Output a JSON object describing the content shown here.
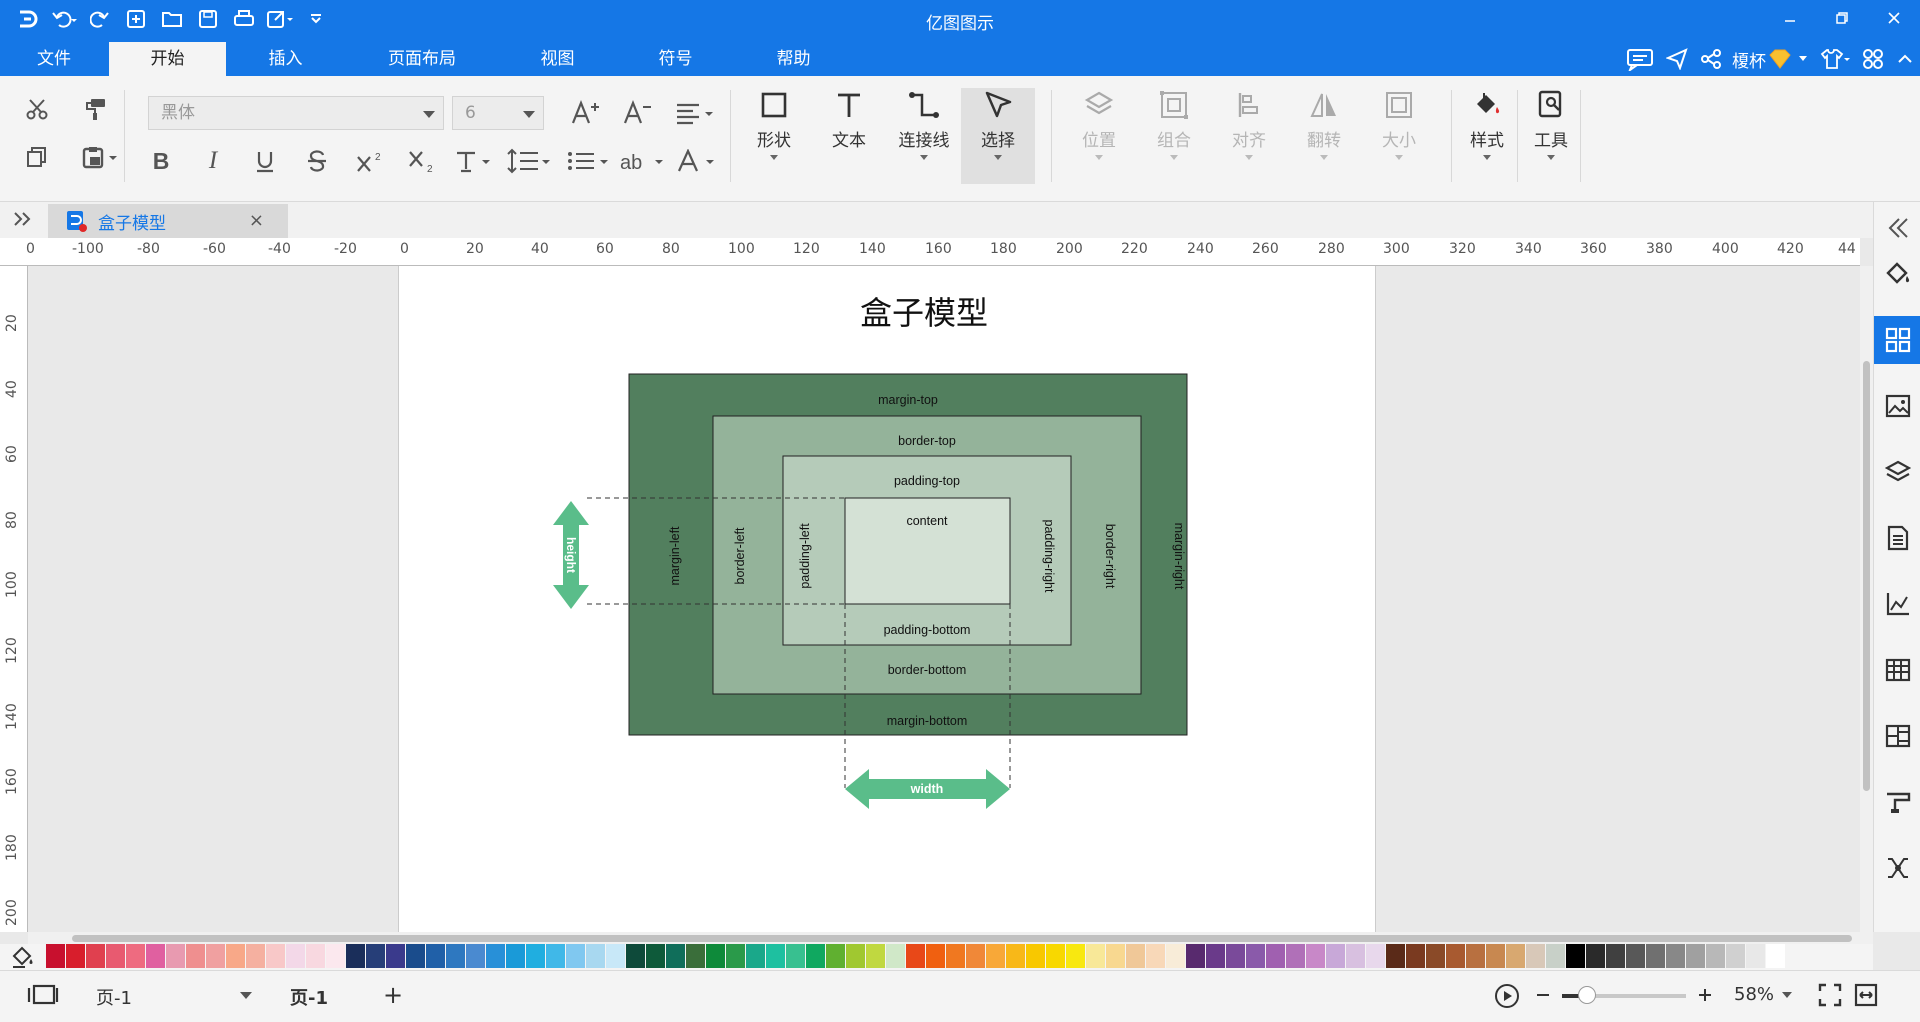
{
  "app": {
    "title": "亿图图示",
    "user": "榎杯"
  },
  "menus": [
    "文件",
    "开始",
    "插入",
    "页面布局",
    "视图",
    "符号",
    "帮助"
  ],
  "ribbon": {
    "font_name": "黑体",
    "font_size": "6",
    "buttons": {
      "shape": "形状",
      "text": "文本",
      "connector": "连接线",
      "select": "选择",
      "position": "位置",
      "group": "组合",
      "align": "对齐",
      "flip": "翻转",
      "size": "大小",
      "style": "样式",
      "tools": "工具"
    }
  },
  "document": {
    "tab_title": "盒子模型",
    "close": "×"
  },
  "ruler": {
    "h": [
      "0",
      "-100",
      "-80",
      "-60",
      "-40",
      "-20",
      "0",
      "20",
      "40",
      "60",
      "80",
      "100",
      "120",
      "140",
      "160",
      "180",
      "200",
      "220",
      "240",
      "260",
      "280",
      "300",
      "320",
      "340",
      "360",
      "380",
      "400",
      "420",
      "44"
    ],
    "v": [
      "20",
      "40",
      "60",
      "80",
      "100",
      "120",
      "140",
      "160",
      "180",
      "200"
    ]
  },
  "diagram": {
    "title": "盒子模型",
    "margin_top": "margin-top",
    "border_top": "border-top",
    "padding_top": "padding-top",
    "content": "content",
    "padding_bottom": "padding-bottom",
    "border_bottom": "border-bottom",
    "margin_bottom": "margin-bottom",
    "margin_left": "margin-left",
    "border_left": "border-left",
    "padding_left": "padding-left",
    "padding_right": "padding-right",
    "border_right": "border-right",
    "margin_right": "margin-right",
    "height": "height",
    "width": "width",
    "colors": {
      "margin": "#527f5e",
      "border": "#94b39a",
      "padding": "#b5cbb9",
      "content": "#d4e1d5",
      "arrow": "#5abd8a"
    }
  },
  "palette": [
    "#c8102e",
    "#d81e2c",
    "#e0404f",
    "#e85a70",
    "#ee6b80",
    "#e060a0",
    "#e89ab0",
    "#ef8f8f",
    "#f0a0a0",
    "#f8a888",
    "#f5b0a0",
    "#f8c8c8",
    "#f3d8e8",
    "#f8d8e0",
    "#fbe8ee",
    "#1a2e5a",
    "#263e78",
    "#3a3a8c",
    "#1a4c8c",
    "#2060a8",
    "#2e78c0",
    "#4a8ad0",
    "#2890d8",
    "#1a9ad8",
    "#20aee0",
    "#40b8e8",
    "#80c8f0",
    "#a8d8f0",
    "#c8e8f8",
    "#0e4a3a",
    "#0e5a3a",
    "#106e5a",
    "#3a6e3a",
    "#0e8a3a",
    "#2a9a4a",
    "#1aa88a",
    "#1ec0a0",
    "#38c090",
    "#10a860",
    "#60b030",
    "#a0c830",
    "#c0d840",
    "#d0e8c8",
    "#e84818",
    "#f06010",
    "#f07820",
    "#f08838",
    "#f8a838",
    "#f8b818",
    "#f8c800",
    "#f8d800",
    "#f8e810",
    "#f8e898",
    "#f8d890",
    "#f0c898",
    "#f8d8b8",
    "#f8ecd8",
    "#582a6e",
    "#6a3a8a",
    "#7a4a9a",
    "#8a5aaa",
    "#a060b0",
    "#b070b8",
    "#c888c8",
    "#c8a8d8",
    "#d8c0e0",
    "#e8d8ec",
    "#5a2a18",
    "#7a3a20",
    "#8a4a28",
    "#a85a30",
    "#b87040",
    "#c88850",
    "#d8a870",
    "#d8c8b8",
    "#c8d0c8",
    "#000000",
    "#2a2a2a",
    "#404040",
    "#585858",
    "#707070",
    "#888888",
    "#a0a0a0",
    "#b8b8b8",
    "#d0d0d0",
    "#e8e8e8",
    "#ffffff"
  ],
  "status": {
    "page_select": "页-1",
    "page_tab": "页-1",
    "add": "+",
    "zoom": "58%"
  }
}
